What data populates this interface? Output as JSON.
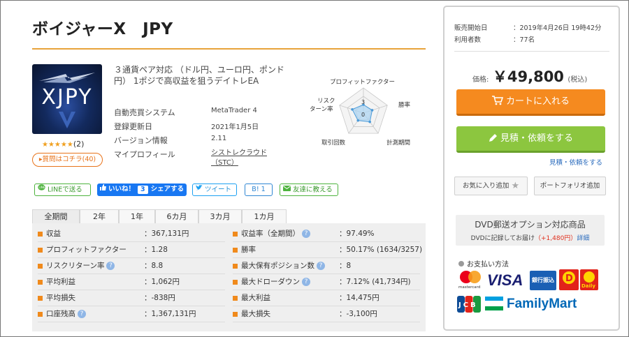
{
  "title": "ボイジャーX　JPY",
  "logo": {
    "text": "XJPY"
  },
  "rating": {
    "stars": "★★★★★",
    "count": "(2)",
    "value": 5
  },
  "qa_button": "▸質問はコチラ(40)",
  "description": "３通貨ペア対応 （ドル円、ユーロ円、ポンド円） 1ポジで高収益を狙うデイトレEA",
  "specs": [
    {
      "label": "自動売買システム",
      "value": "MetaTrader 4"
    },
    {
      "label": "登録更新日",
      "value": "2021年1月5日"
    },
    {
      "label": "バージョン情報",
      "value": "2.11"
    },
    {
      "label": "マイプロフィール",
      "value": "シストレクラウド （STC）"
    }
  ],
  "radar": {
    "axes": [
      "プロフィットファクター",
      "勝率",
      "計測期間",
      "取引回数",
      "リスクターン率"
    ],
    "scale_labels": [
      "3",
      "0"
    ],
    "values": [
      1.0,
      1.1,
      1.3,
      1.1,
      1.4
    ],
    "max": 3
  },
  "share": {
    "line": "LINEで送る",
    "fb_label": "いいね！",
    "fb_count": "3",
    "fb_share": "シェアする",
    "tweet": "ツイート",
    "hatena": "B!",
    "hatena_count": "1",
    "mail": "友達に教える"
  },
  "tabs": [
    "全期間",
    "2年",
    "1年",
    "6カ月",
    "3カ月",
    "1カ月"
  ],
  "stats_left": [
    {
      "label": "収益",
      "value": "：367,131円",
      "help": false
    },
    {
      "label": "プロフィットファクター",
      "value": "：1.28",
      "help": false
    },
    {
      "label": "リスクリターン率",
      "value": "：8.8",
      "help": true
    },
    {
      "label": "平均利益",
      "value": "：1,062円",
      "help": false
    },
    {
      "label": "平均損失",
      "value": "：-838円",
      "help": false
    },
    {
      "label": "口座残高",
      "value": "：1,367,131円",
      "help": true
    }
  ],
  "stats_right": [
    {
      "label": "収益率（全期間）",
      "value": "：97.49%",
      "help": true
    },
    {
      "label": "勝率",
      "value": "：50.17% (1634/3257)",
      "help": false
    },
    {
      "label": "最大保有ポジション数",
      "value": "：8",
      "help": true
    },
    {
      "label": "最大ドローダウン",
      "value": "：7.12% (41,734円)",
      "help": true
    },
    {
      "label": "最大利益",
      "value": "：14,475円",
      "help": false
    },
    {
      "label": "最大損失",
      "value": "：-3,100円",
      "help": false
    }
  ],
  "sidebar": {
    "release_label": "販売開始日",
    "release_value": "：2019年4月26日 19時42分",
    "users_label": "利用者数",
    "users_value": "：77名",
    "price_label": "価格:",
    "price_value": "￥49,800",
    "price_tax": "(税込)",
    "cart_button": "カートに入れる",
    "quote_button": "見積・依頼をする",
    "quote_link": "見積・依頼をする",
    "favorite_button": "お気に入り追加",
    "portfolio_button": "ポートフォリオ追加",
    "dvd_title": "DVD郵送オプション対応商品",
    "dvd_text": "DVDに記録してお届け",
    "dvd_price": "（+1,480円）",
    "dvd_link": "詳細",
    "payment_title": "お支払い方法",
    "payment_methods": [
      "mastercard",
      "VISA",
      "銀行振込",
      "D",
      "Daily",
      "JCB",
      "FamilyMart"
    ]
  },
  "colors": {
    "accent_orange": "#f58a1f",
    "green": "#8cc63f",
    "link_blue": "#2a6bbd",
    "facebook": "#1877f2"
  }
}
